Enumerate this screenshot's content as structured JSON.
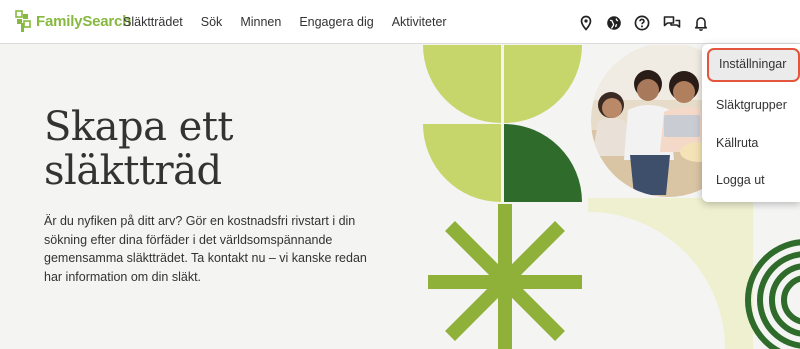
{
  "brand": {
    "name": "FamilySearch",
    "color": "#87b940"
  },
  "nav": {
    "items": [
      "Släktträdet",
      "Sök",
      "Minnen",
      "Engagera dig",
      "Aktiviteter"
    ]
  },
  "header_icons": [
    "location-pin-icon",
    "globe-icon",
    "help-icon",
    "chat-icon",
    "bell-icon"
  ],
  "hero": {
    "title_line1": "Skapa ett",
    "title_line2": "släktträd",
    "body": "Är du nyfiken på ditt arv? Gör en kostnadsfri rivstart i din sökning efter dina förfäder i det världsomspännande gemensamma släktträdet. Ta kontakt nu – vi kanske redan har information om din släkt."
  },
  "dropdown": {
    "items": [
      "Inställningar",
      "Släktgrupper",
      "Källruta",
      "Logga ut"
    ],
    "highlighted": "Inställningar",
    "highlight_color": "#e3563d"
  },
  "colors": {
    "light_green": "#c6d66a",
    "dark_green": "#2f6b2a",
    "mid_green": "#8fb13a",
    "pale_green": "#eef0cf"
  }
}
